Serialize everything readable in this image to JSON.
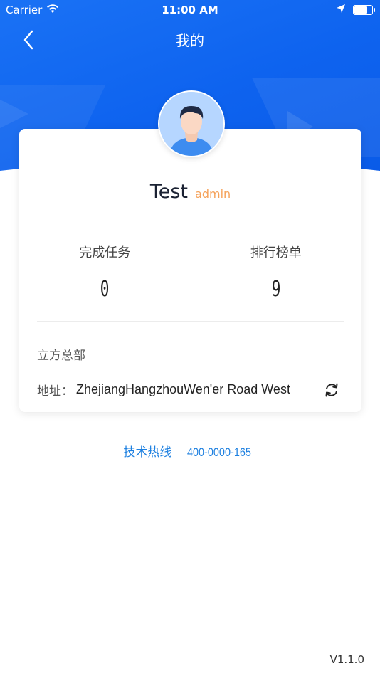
{
  "status_bar": {
    "carrier": "Carrier",
    "time": "11:00 AM",
    "battery_level": 0.7
  },
  "nav": {
    "title": "我的"
  },
  "profile": {
    "name": "Test",
    "role": "admin"
  },
  "stats": [
    {
      "label": "完成任务",
      "value": "0"
    },
    {
      "label": "排行榜单",
      "value": "9"
    }
  ],
  "org": {
    "name": "立方总部",
    "address_label": "地址：",
    "address_value": "ZhejiangHangzhouWen'er Road West"
  },
  "hotline": {
    "label": "技术热线",
    "number": "400-0000-165"
  },
  "version": "V1.1.0",
  "colors": {
    "header_blue": "#1a72f5",
    "role_orange": "#f5a25a",
    "hotline_blue": "#1e80e0",
    "avatar_bg": "#b6d6ff"
  },
  "icons": [
    "wifi-icon",
    "location-arrow-icon",
    "battery-icon",
    "back-chevron-icon",
    "refresh-icon",
    "avatar-icon"
  ]
}
